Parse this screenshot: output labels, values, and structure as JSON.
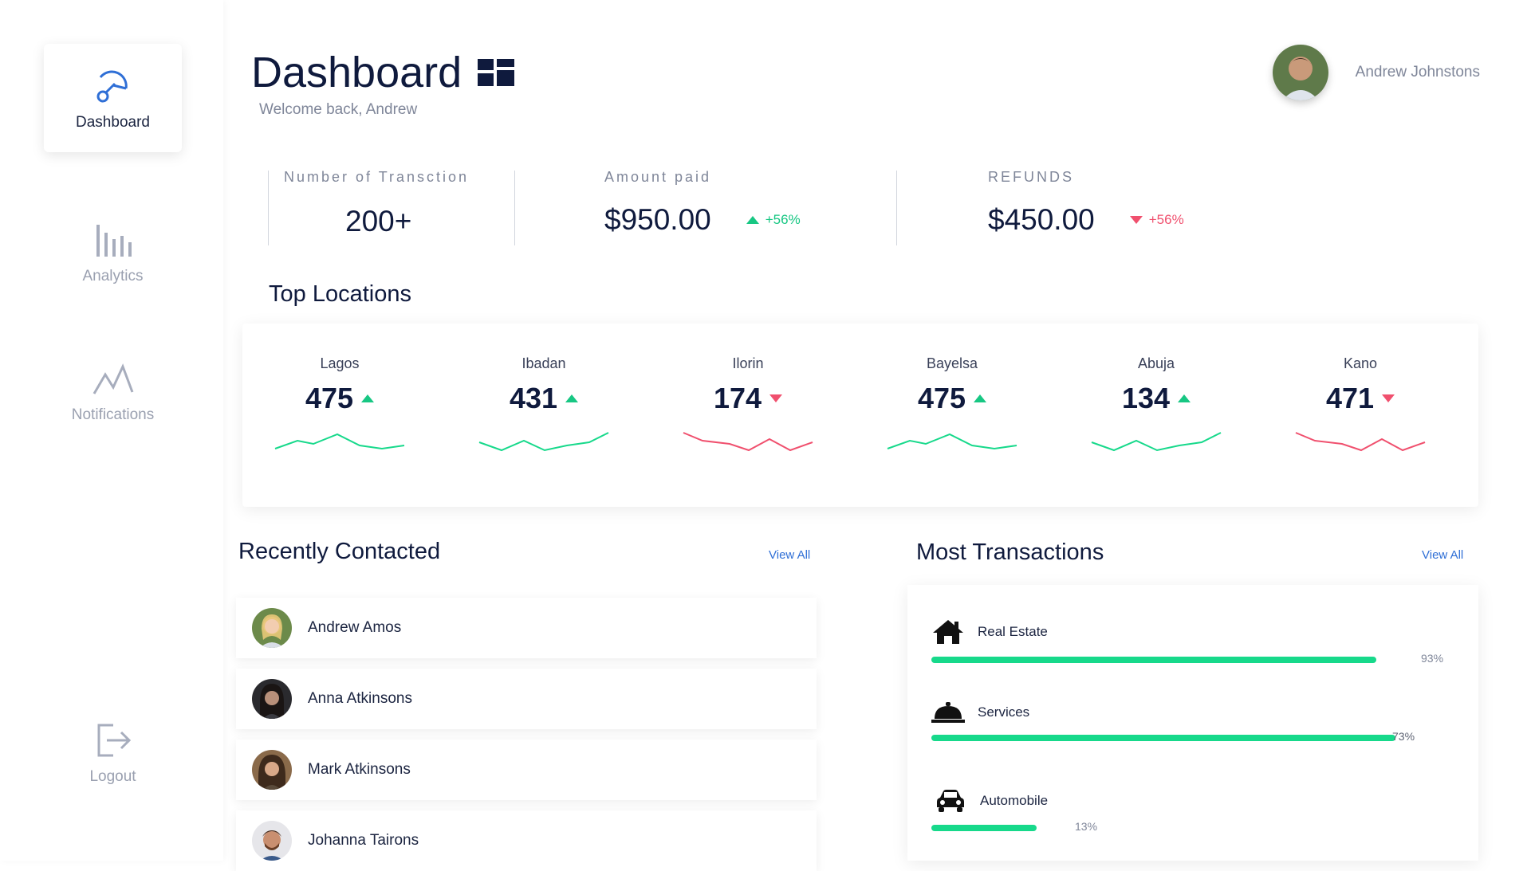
{
  "sidebar": {
    "items": [
      {
        "label": "Dashboard",
        "icon": "gauge-icon",
        "active": true
      },
      {
        "label": "Analytics",
        "icon": "bar-chart-icon",
        "active": false
      },
      {
        "label": "Notifications",
        "icon": "activity-wave-icon",
        "active": false
      },
      {
        "label": "Logout",
        "icon": "logout-icon",
        "active": false
      }
    ]
  },
  "header": {
    "title": "Dashboard",
    "title_icon": "grid-icon",
    "subtitle": "Welcome back, Andrew",
    "user_name": "Andrew Johnstons"
  },
  "stats": [
    {
      "label": "Number of Transction",
      "value": "200+"
    },
    {
      "label": "Amount paid",
      "value": "$950.00",
      "delta": "+56%",
      "direction": "up"
    },
    {
      "label": "REFUNDS",
      "value": "$450.00",
      "delta": "+56%",
      "direction": "down"
    }
  ],
  "top_locations": {
    "title": "Top Locations",
    "items": [
      {
        "name": "Lagos",
        "value": "475",
        "direction": "up"
      },
      {
        "name": "Ibadan",
        "value": "431",
        "direction": "up"
      },
      {
        "name": "Ilorin",
        "value": "174",
        "direction": "down"
      },
      {
        "name": "Bayelsa",
        "value": "475",
        "direction": "up"
      },
      {
        "name": "Abuja",
        "value": "134",
        "direction": "up"
      },
      {
        "name": "Kano",
        "value": "471",
        "direction": "down"
      }
    ]
  },
  "recently_contacted": {
    "title": "Recently Contacted",
    "view_all": "View All",
    "contacts": [
      {
        "name": "Andrew Amos"
      },
      {
        "name": "Anna Atkinsons"
      },
      {
        "name": "Mark Atkinsons"
      },
      {
        "name": "Johanna Tairons"
      }
    ]
  },
  "most_transactions": {
    "title": "Most Transactions",
    "view_all": "View All",
    "items": [
      {
        "label": "Real Estate",
        "percent": "93%",
        "fraction": 0.93,
        "icon": "house-icon"
      },
      {
        "label": "Services",
        "percent": "73%",
        "fraction": 0.97,
        "icon": "cloche-icon"
      },
      {
        "label": "Automobile",
        "percent": "13%",
        "fraction": 0.22,
        "icon": "car-icon"
      }
    ]
  },
  "colors": {
    "up": "#17c783",
    "down": "#f0506e",
    "accent": "#2f6fd6",
    "bar": "#17d98b"
  }
}
